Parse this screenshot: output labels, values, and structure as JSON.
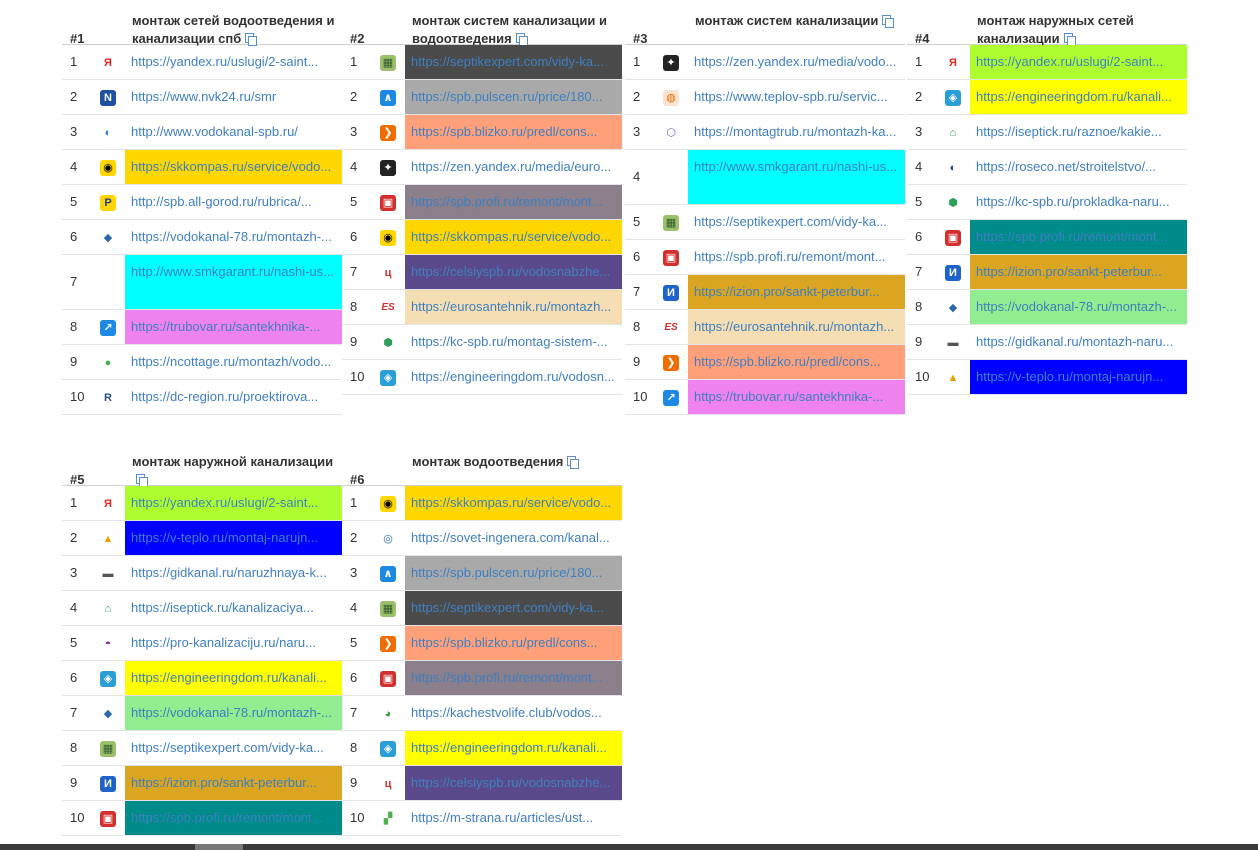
{
  "panels": [
    {
      "num": "#1",
      "title": "монтаж сетей водоотведения и канализации спб",
      "rows": [
        {
          "rank": "1",
          "icon": "yandex-icon",
          "url": "https://yandex.ru/uslugi/2-saint...",
          "bg": ""
        },
        {
          "rank": "2",
          "icon": "nvk24-icon",
          "url": "https://www.nvk24.ru/smr",
          "bg": ""
        },
        {
          "rank": "3",
          "icon": "vodokanal-spb-icon",
          "url": "http://www.vodokanal-spb.ru/",
          "bg": ""
        },
        {
          "rank": "4",
          "icon": "skkompas-icon",
          "url": "https://skkompas.ru/service/vodo...",
          "bg": "#ffd700"
        },
        {
          "rank": "5",
          "icon": "all-gorod-icon",
          "url": "http://spb.all-gorod.ru/rubrica/...",
          "bg": ""
        },
        {
          "rank": "6",
          "icon": "vodokanal-78-icon",
          "url": "https://vodokanal-78.ru/montazh-...",
          "bg": ""
        },
        {
          "rank": "7",
          "icon": "",
          "url": "http://www.smkgarant.ru/nashi-us...",
          "bg": "#00ffff",
          "tall": true
        },
        {
          "rank": "8",
          "icon": "trubovar-icon",
          "url": "https://trubovar.ru/santekhnika-...",
          "bg": "#ee82ee"
        },
        {
          "rank": "9",
          "icon": "ncottage-icon",
          "url": "https://ncottage.ru/montazh/vodo...",
          "bg": ""
        },
        {
          "rank": "10",
          "icon": "dc-region-icon",
          "url": "https://dc-region.ru/proektirova...",
          "bg": ""
        }
      ]
    },
    {
      "num": "#2",
      "title": "монтаж систем канализации и водоотведения",
      "rows": [
        {
          "rank": "1",
          "icon": "septikexpert-icon",
          "url": "https://septikexpert.com/vidy-ka...",
          "bg": "#4b4b4b"
        },
        {
          "rank": "2",
          "icon": "pulscen-icon",
          "url": "https://spb.pulscen.ru/price/180...",
          "bg": "#a9a9a9"
        },
        {
          "rank": "3",
          "icon": "blizko-icon",
          "url": "https://spb.blizko.ru/predl/cons...",
          "bg": "#ffa07a"
        },
        {
          "rank": "4",
          "icon": "zen-yandex-icon",
          "url": "https://zen.yandex.ru/media/euro...",
          "bg": ""
        },
        {
          "rank": "5",
          "icon": "profi-icon",
          "url": "https://spb.profi.ru/remont/mont...",
          "bg": "#8a7f8a"
        },
        {
          "rank": "6",
          "icon": "skkompas-icon",
          "url": "https://skkompas.ru/service/vodo...",
          "bg": "#ffd700"
        },
        {
          "rank": "7",
          "icon": "celsiy-icon",
          "url": "https://celsiyspb.ru/vodosnabzhe...",
          "bg": "#5b4a8b"
        },
        {
          "rank": "8",
          "icon": "eurosantehnik-icon",
          "url": "https://eurosantehnik.ru/montazh...",
          "bg": "#f5deb3"
        },
        {
          "rank": "9",
          "icon": "kc-spb-icon",
          "url": "https://kc-spb.ru/montag-sistem-...",
          "bg": ""
        },
        {
          "rank": "10",
          "icon": "engineeringdom-icon",
          "url": "https://engineeringdom.ru/vodosn...",
          "bg": ""
        }
      ]
    },
    {
      "num": "#3",
      "title": "монтаж систем канализации",
      "rows": [
        {
          "rank": "1",
          "icon": "zen-yandex-icon",
          "url": "https://zen.yandex.ru/media/vodo...",
          "bg": ""
        },
        {
          "rank": "2",
          "icon": "teplov-icon",
          "url": "https://www.teplov-spb.ru/servic...",
          "bg": ""
        },
        {
          "rank": "3",
          "icon": "montagtrub-icon",
          "url": "https://montagtrub.ru/montazh-ka...",
          "bg": ""
        },
        {
          "rank": "4",
          "icon": "",
          "url": "http://www.smkgarant.ru/nashi-us...",
          "bg": "#00ffff",
          "tall": true
        },
        {
          "rank": "5",
          "icon": "septikexpert-icon",
          "url": "https://septikexpert.com/vidy-ka...",
          "bg": ""
        },
        {
          "rank": "6",
          "icon": "profi-icon",
          "url": "https://spb.profi.ru/remont/mont...",
          "bg": ""
        },
        {
          "rank": "7",
          "icon": "izion-icon",
          "url": "https://izion.pro/sankt-peterbur...",
          "bg": "#daa520"
        },
        {
          "rank": "8",
          "icon": "eurosantehnik-icon",
          "url": "https://eurosantehnik.ru/montazh...",
          "bg": "#f5deb3"
        },
        {
          "rank": "9",
          "icon": "blizko-icon",
          "url": "https://spb.blizko.ru/predl/cons...",
          "bg": "#ffa07a"
        },
        {
          "rank": "10",
          "icon": "trubovar-icon",
          "url": "https://trubovar.ru/santekhnika-...",
          "bg": "#ee82ee"
        }
      ]
    },
    {
      "num": "#4",
      "title": "монтаж наружных сетей канализации",
      "rows": [
        {
          "rank": "1",
          "icon": "yandex-icon",
          "url": "https://yandex.ru/uslugi/2-saint...",
          "bg": "#adff2f"
        },
        {
          "rank": "2",
          "icon": "engineeringdom-icon",
          "url": "https://engineeringdom.ru/kanali...",
          "bg": "#ffff00"
        },
        {
          "rank": "3",
          "icon": "iseptick-icon",
          "url": "https://iseptick.ru/raznoe/kakie...",
          "bg": ""
        },
        {
          "rank": "4",
          "icon": "roseco-icon",
          "url": "https://roseco.net/stroitelstvo/...",
          "bg": ""
        },
        {
          "rank": "5",
          "icon": "kc-spb-icon",
          "url": "https://kc-spb.ru/prokladka-naru...",
          "bg": ""
        },
        {
          "rank": "6",
          "icon": "profi-icon",
          "url": "https://spb.profi.ru/remont/mont...",
          "bg": "#008b8b"
        },
        {
          "rank": "7",
          "icon": "izion-icon",
          "url": "https://izion.pro/sankt-peterbur...",
          "bg": "#daa520"
        },
        {
          "rank": "8",
          "icon": "vodokanal-78-icon",
          "url": "https://vodokanal-78.ru/montazh-...",
          "bg": "#90ee90"
        },
        {
          "rank": "9",
          "icon": "gidkanal-icon",
          "url": "https://gidkanal.ru/montazh-naru...",
          "bg": ""
        },
        {
          "rank": "10",
          "icon": "v-teplo-icon",
          "url": "https://v-teplo.ru/montaj-narujn...",
          "bg": "#0000ff"
        }
      ]
    },
    {
      "num": "#5",
      "title": "монтаж наружной канализации",
      "rows": [
        {
          "rank": "1",
          "icon": "yandex-icon",
          "url": "https://yandex.ru/uslugi/2-saint...",
          "bg": "#adff2f"
        },
        {
          "rank": "2",
          "icon": "v-teplo-icon",
          "url": "https://v-teplo.ru/montaj-narujn...",
          "bg": "#0000ff"
        },
        {
          "rank": "3",
          "icon": "gidkanal-icon",
          "url": "https://gidkanal.ru/naruzhnaya-k...",
          "bg": ""
        },
        {
          "rank": "4",
          "icon": "iseptick-icon",
          "url": "https://iseptick.ru/kanalizaciya...",
          "bg": ""
        },
        {
          "rank": "5",
          "icon": "pro-kanalizaciju-icon",
          "url": "https://pro-kanalizaciju.ru/naru...",
          "bg": ""
        },
        {
          "rank": "6",
          "icon": "engineeringdom-icon",
          "url": "https://engineeringdom.ru/kanali...",
          "bg": "#ffff00"
        },
        {
          "rank": "7",
          "icon": "vodokanal-78-icon",
          "url": "https://vodokanal-78.ru/montazh-...",
          "bg": "#90ee90"
        },
        {
          "rank": "8",
          "icon": "septikexpert-icon",
          "url": "https://septikexpert.com/vidy-ka...",
          "bg": ""
        },
        {
          "rank": "9",
          "icon": "izion-icon",
          "url": "https://izion.pro/sankt-peterbur...",
          "bg": "#daa520"
        },
        {
          "rank": "10",
          "icon": "profi-icon",
          "url": "https://spb.profi.ru/remont/mont...",
          "bg": "#008b8b"
        }
      ]
    },
    {
      "num": "#6",
      "title": "монтаж водоотведения",
      "rows": [
        {
          "rank": "1",
          "icon": "skkompas-icon",
          "url": "https://skkompas.ru/service/vodo...",
          "bg": "#ffd700"
        },
        {
          "rank": "2",
          "icon": "sovet-ingenera-icon",
          "url": "https://sovet-ingenera.com/kanal...",
          "bg": ""
        },
        {
          "rank": "3",
          "icon": "pulscen-icon",
          "url": "https://spb.pulscen.ru/price/180...",
          "bg": "#a9a9a9"
        },
        {
          "rank": "4",
          "icon": "septikexpert-icon",
          "url": "https://septikexpert.com/vidy-ka...",
          "bg": "#4b4b4b"
        },
        {
          "rank": "5",
          "icon": "blizko-icon",
          "url": "https://spb.blizko.ru/predl/cons...",
          "bg": "#ffa07a"
        },
        {
          "rank": "6",
          "icon": "profi-icon",
          "url": "https://spb.profi.ru/remont/mont...",
          "bg": "#8a7f8a"
        },
        {
          "rank": "7",
          "icon": "kachestvolife-icon",
          "url": "https://kachestvolife.club/vodos...",
          "bg": ""
        },
        {
          "rank": "8",
          "icon": "engineeringdom-icon",
          "url": "https://engineeringdom.ru/kanali...",
          "bg": "#ffff00"
        },
        {
          "rank": "9",
          "icon": "celsiy-icon",
          "url": "https://celsiyspb.ru/vodosnabzhe...",
          "bg": "#5b4a8b"
        },
        {
          "rank": "10",
          "icon": "m-strana-icon",
          "url": "https://m-strana.ru/articles/ust...",
          "bg": ""
        }
      ]
    }
  ],
  "icon_styles": {
    "yandex-icon": {
      "glyph": "Я",
      "fg": "#e52620",
      "bg": "transparent"
    },
    "nvk24-icon": {
      "glyph": "N",
      "fg": "#ffffff",
      "bg": "#1e4fa0"
    },
    "vodokanal-spb-icon": {
      "glyph": "◐",
      "fg": "#1f7fd6",
      "bg": "transparent"
    },
    "skkompas-icon": {
      "glyph": "◉",
      "fg": "#000000",
      "bg": "#ffd600"
    },
    "all-gorod-icon": {
      "glyph": "Р",
      "fg": "#1a3c8f",
      "bg": "#ffd600"
    },
    "vodokanal-78-icon": {
      "glyph": "◆",
      "fg": "#2b6aa8",
      "bg": "transparent"
    },
    "trubovar-icon": {
      "glyph": "↗",
      "fg": "#ffffff",
      "bg": "#1e88e5"
    },
    "ncottage-icon": {
      "glyph": "●",
      "fg": "#4caf50",
      "bg": "transparent"
    },
    "dc-region-icon": {
      "glyph": "R",
      "fg": "#2e4f86",
      "bg": "transparent"
    },
    "septikexpert-icon": {
      "glyph": "▦",
      "fg": "#2f5a2b",
      "bg": "#9bbf6a"
    },
    "pulscen-icon": {
      "glyph": "∧",
      "fg": "#ffffff",
      "bg": "#1e88e5"
    },
    "blizko-icon": {
      "glyph": "❯",
      "fg": "#ffffff",
      "bg": "#ef6c00"
    },
    "zen-yandex-icon": {
      "glyph": "✦",
      "fg": "#ffffff",
      "bg": "#222222"
    },
    "profi-icon": {
      "glyph": "▣",
      "fg": "#ffffff",
      "bg": "#d32f2f"
    },
    "celsiy-icon": {
      "glyph": "ц",
      "fg": "#d32f2f",
      "bg": "transparent"
    },
    "eurosantehnik-icon": {
      "glyph": "ES",
      "fg": "#d32f2f",
      "bg": "transparent"
    },
    "kc-spb-icon": {
      "glyph": "⬢",
      "fg": "#2e9e5b",
      "bg": "transparent"
    },
    "engineeringdom-icon": {
      "glyph": "◈",
      "fg": "#ffffff",
      "bg": "#2a9fd6"
    },
    "teplov-icon": {
      "glyph": "◍",
      "fg": "#ef6c00",
      "bg": "#fbe3cf"
    },
    "montagtrub-icon": {
      "glyph": "⬡",
      "fg": "#7b5cc7",
      "bg": "transparent"
    },
    "izion-icon": {
      "glyph": "И",
      "fg": "#ffffff",
      "bg": "#1e64c8"
    },
    "iseptick-icon": {
      "glyph": "⌂",
      "fg": "#2e9e5b",
      "bg": "transparent"
    },
    "roseco-icon": {
      "glyph": "◐",
      "fg": "#1a3c8f",
      "bg": "transparent"
    },
    "gidkanal-icon": {
      "glyph": "▬",
      "fg": "#555555",
      "bg": "transparent"
    },
    "v-teplo-icon": {
      "glyph": "▲",
      "fg": "#e8a000",
      "bg": "transparent"
    },
    "pro-kanalizaciju-icon": {
      "glyph": "◓",
      "fg": "#7b2d8e",
      "bg": "transparent"
    },
    "sovet-ingenera-icon": {
      "glyph": "◎",
      "fg": "#2a6fb8",
      "bg": "transparent"
    },
    "kachestvolife-icon": {
      "glyph": "◕",
      "fg": "#3a9b3a",
      "bg": "transparent"
    },
    "m-strana-icon": {
      "glyph": "▞",
      "fg": "#4caf50",
      "bg": "transparent"
    }
  }
}
